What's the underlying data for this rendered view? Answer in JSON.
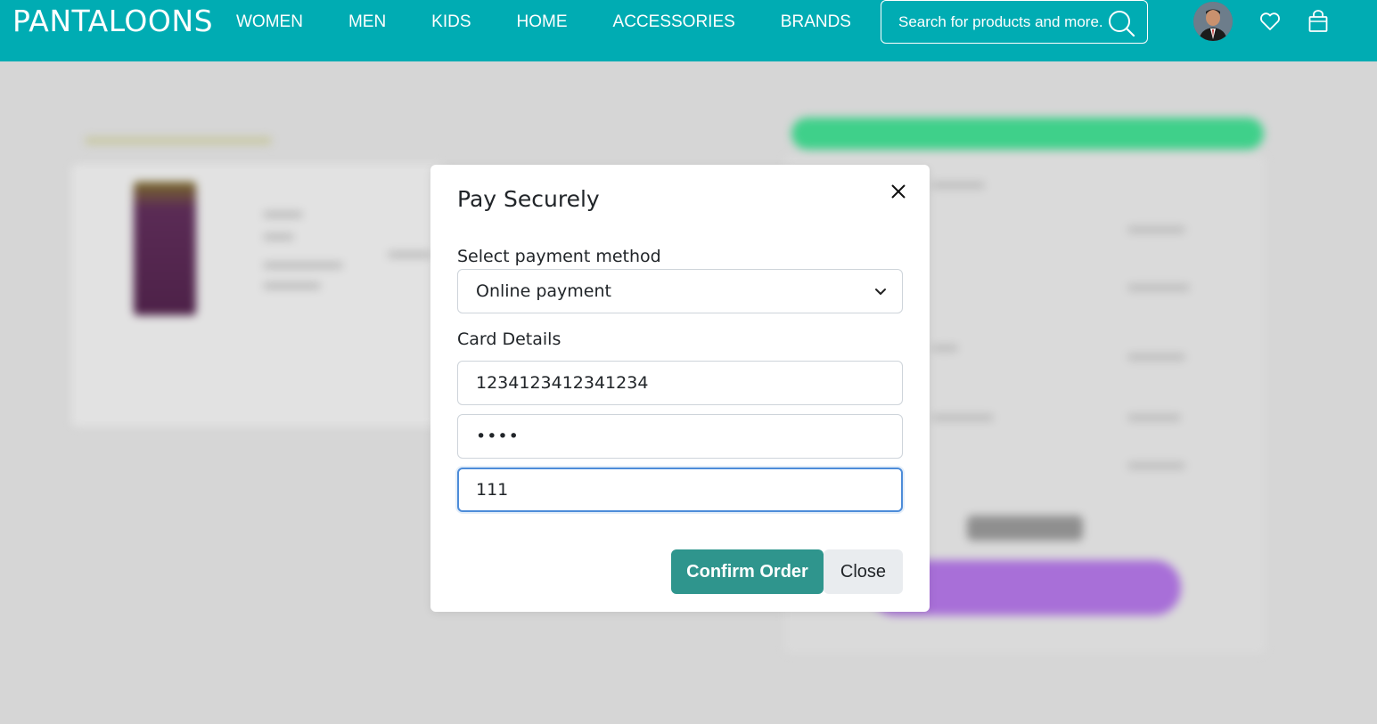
{
  "brand": {
    "logo_text": "PANTALOONS"
  },
  "nav": {
    "items": [
      {
        "label": "WOMEN"
      },
      {
        "label": "MEN"
      },
      {
        "label": "KIDS"
      },
      {
        "label": "HOME"
      },
      {
        "label": "ACCESSORIES"
      },
      {
        "label": "BRANDS"
      }
    ]
  },
  "search": {
    "placeholder": "Search for products and more."
  },
  "header_icons": [
    "avatar",
    "heart-icon",
    "bag-icon",
    "search-icon"
  ],
  "colors": {
    "header_bg": "#00acb3",
    "confirm_button": "#2f958d",
    "overlay_bg": "#d6d6d6"
  },
  "modal": {
    "title": "Pay Securely",
    "payment_method_label": "Select payment method",
    "payment_method_value": "Online payment",
    "card_details_label": "Card Details",
    "card_number": "1234123412341234",
    "expiry_masked": "••••",
    "cvv": "111",
    "confirm_label": "Confirm Order",
    "close_label": "Close"
  }
}
